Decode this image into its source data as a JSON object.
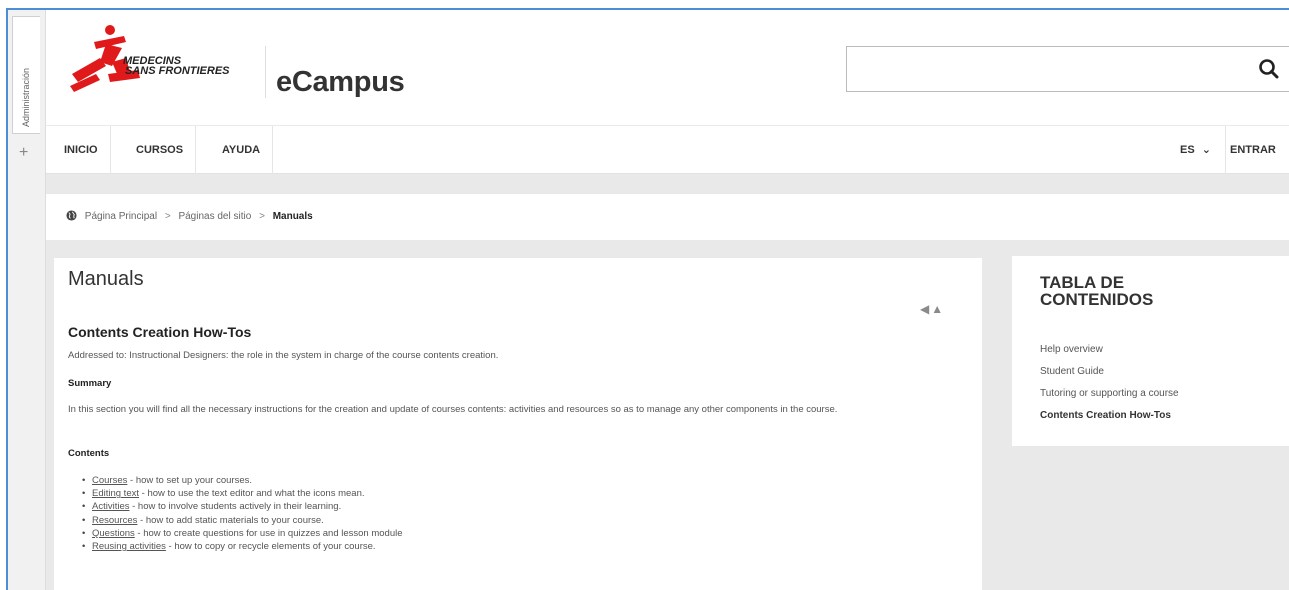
{
  "admin": {
    "tab_label": "Administración",
    "plus": "+"
  },
  "header": {
    "brand": "eCampus",
    "logo_line1": "MEDECINS",
    "logo_line2": "SANS FRONTIERES",
    "search_placeholder": ""
  },
  "nav": {
    "items": [
      "INICIO",
      "CURSOS",
      "AYUDA"
    ],
    "language": "ES",
    "login": "ENTRAR"
  },
  "breadcrumb": {
    "items": [
      "Página Principal",
      "Páginas del sitio",
      "Manuals"
    ]
  },
  "content": {
    "title": "Manuals",
    "nav_arrows": "◀▲",
    "section_title": "Contents Creation How-Tos",
    "addressed": "Addressed to: Instructional Designers: the role in the system in charge of the course contents creation.",
    "summary_heading": "Summary",
    "summary_text": "In this section you will find all the necessary instructions for the creation and update of courses contents: activities and resources so as to manage any other components in the course.",
    "contents_heading": "Contents",
    "contents_list": [
      {
        "link": "Courses",
        "desc": " - how to set up your courses."
      },
      {
        "link": "Editing text",
        "desc": " - how to use the text editor and what the icons mean."
      },
      {
        "link": "Activities",
        "desc": " - how to involve students actively in their learning."
      },
      {
        "link": "Resources",
        "desc": " - how to add static materials to your course."
      },
      {
        "link": "Questions",
        "desc": " - how to create questions for use in quizzes and lesson module"
      },
      {
        "link": "Reusing activities",
        "desc": " - how to copy or recycle elements of your course."
      }
    ]
  },
  "toc": {
    "title": "TABLA DE CONTENIDOS",
    "items": [
      "Help overview",
      "Student Guide",
      "Tutoring or supporting a course",
      "Contents Creation How-Tos"
    ]
  },
  "colors": {
    "logo_red": "#e0191a",
    "frame_blue": "#4a8fd6"
  }
}
